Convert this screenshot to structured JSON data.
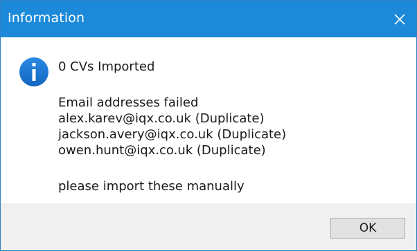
{
  "window": {
    "title": "Information",
    "close_glyph": "✕"
  },
  "message": {
    "summary": "0 CVs Imported",
    "failed_header": "Email addresses failed",
    "failed_entries": [
      "alex.karev@iqx.co.uk (Duplicate)",
      "jackson.avery@iqx.co.uk (Duplicate)",
      "owen.hunt@iqx.co.uk (Duplicate)"
    ],
    "instruction": "please import these manually"
  },
  "icon": {
    "name": "info-icon",
    "glyph": "i",
    "color": "#1c7ad8"
  },
  "buttons": {
    "ok_label": "OK"
  },
  "colors": {
    "titlebar": "#1c8ad8",
    "footer": "#f0f0f0"
  }
}
